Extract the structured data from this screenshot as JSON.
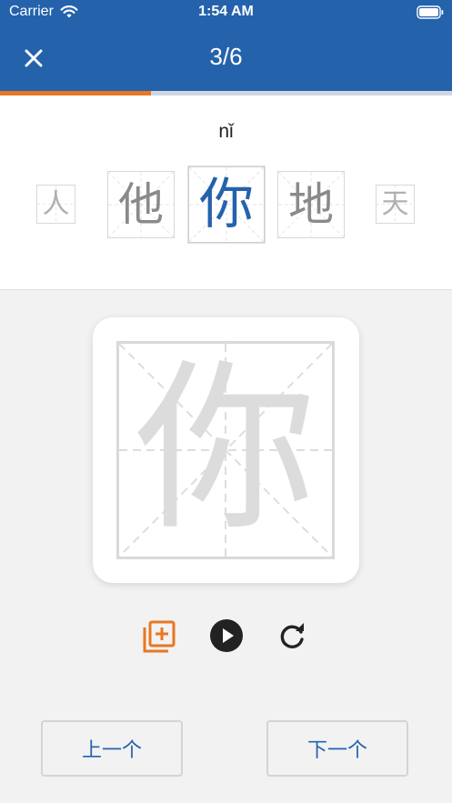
{
  "status_bar": {
    "carrier": "Carrier",
    "time": "1:54 AM",
    "wifi_icon": "wifi-icon",
    "battery_icon": "battery-icon"
  },
  "header": {
    "close_icon": "close-icon",
    "page_counter": "3/6",
    "progress_fraction": 0.333,
    "colors": {
      "background": "#2462ac",
      "progress": "#e87722"
    }
  },
  "character_strip": {
    "pinyin": "nǐ",
    "characters": [
      {
        "char": "人",
        "state": "far"
      },
      {
        "char": "他",
        "state": "near"
      },
      {
        "char": "你",
        "state": "current"
      },
      {
        "char": "地",
        "state": "near"
      },
      {
        "char": "天",
        "state": "far"
      }
    ],
    "active_color": "#2462ac"
  },
  "writing_pad": {
    "character": "你"
  },
  "tools": [
    {
      "icon": "add-to-collection-icon",
      "color": "#e87722"
    },
    {
      "icon": "play-icon",
      "color": "#222222"
    },
    {
      "icon": "replay-icon",
      "color": "#222222"
    }
  ],
  "navigation": {
    "prev_label": "上一个",
    "next_label": "下一个"
  }
}
